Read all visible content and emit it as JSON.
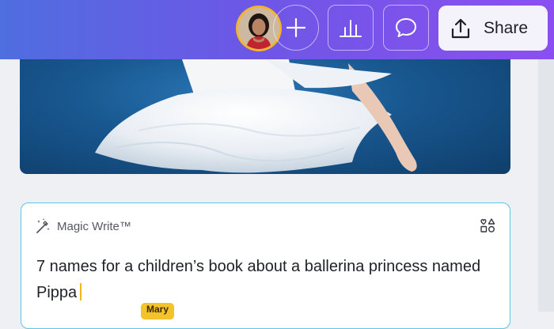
{
  "toolbar": {
    "share_label": "Share",
    "accent_gradient": [
      "#4f6ee0",
      "#8b4ff0"
    ],
    "icons": [
      "avatar",
      "plus-icon",
      "bar-chart-icon",
      "comment-icon",
      "share-upload-icon"
    ]
  },
  "magic_write": {
    "title": "Magic Write™",
    "prompt": "7 names for a children’s book about a ballerina princess named Pippa",
    "collaborator_label": "Mary",
    "border_color": "#5bc5e4"
  }
}
